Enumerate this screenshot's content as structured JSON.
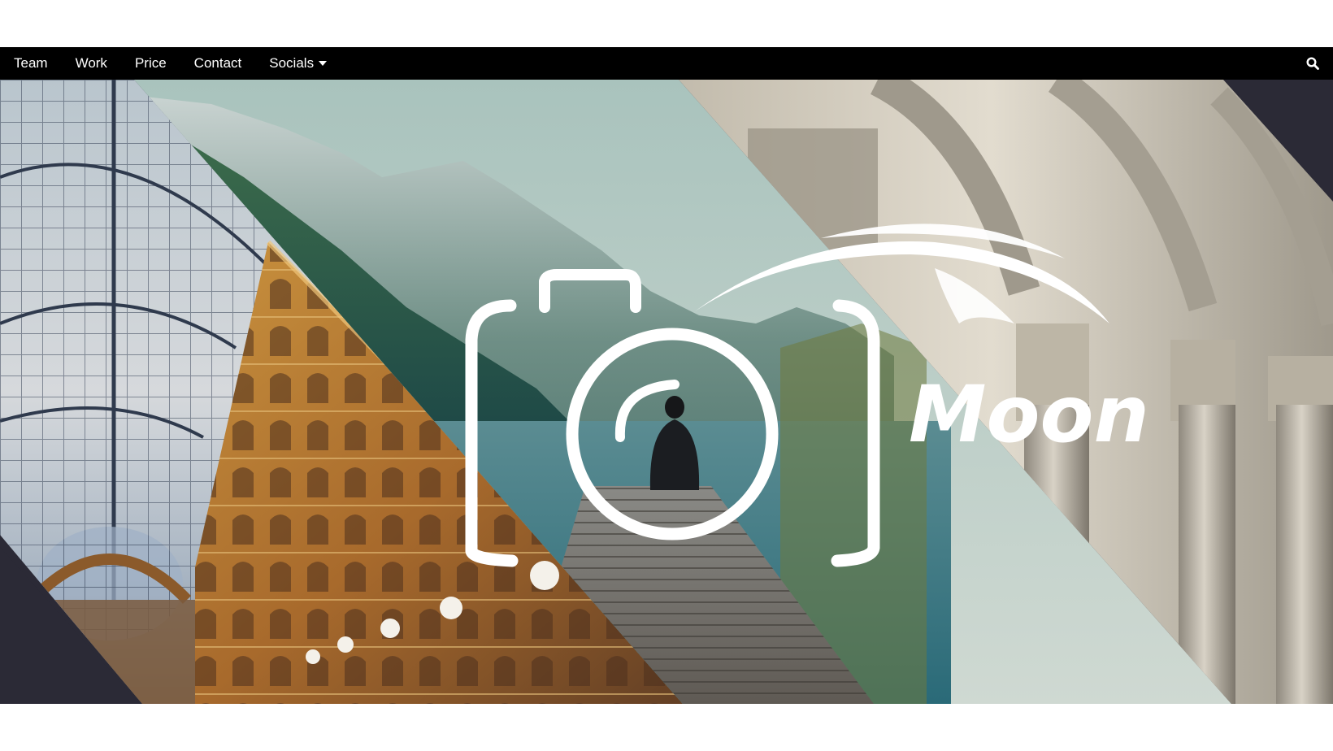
{
  "nav": {
    "items": [
      {
        "label": "Team"
      },
      {
        "label": "Work"
      },
      {
        "label": "Price"
      },
      {
        "label": "Contact"
      },
      {
        "label": "Socials"
      }
    ],
    "search_icon": "search-icon",
    "dropdown_icon": "caret-down-icon"
  },
  "hero": {
    "logo_text": "Moon",
    "logo_icon": "camera-icon",
    "panels": [
      "glass-gallery-photo",
      "mountain-lake-photo",
      "stone-columns-photo"
    ]
  },
  "colors": {
    "navbar": "#000000",
    "nav_text": "#ffffff",
    "dark_corner": "#2b2a36",
    "logo": "#ffffff"
  }
}
